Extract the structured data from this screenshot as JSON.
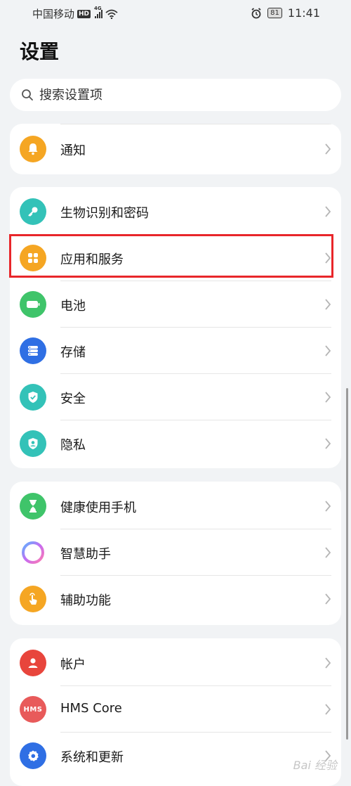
{
  "status_bar": {
    "carrier": "中国移动",
    "hd_badge": "HD",
    "network": "4G",
    "battery": "81",
    "time": "11:41"
  },
  "page": {
    "title": "设置"
  },
  "search": {
    "placeholder": "搜索设置项"
  },
  "groups": [
    {
      "items": [
        {
          "label": "通知",
          "icon": "bell-icon",
          "color": "#f5a623"
        }
      ]
    },
    {
      "items": [
        {
          "label": "生物识别和密码",
          "icon": "key-icon",
          "color": "#33c2b8"
        },
        {
          "label": "应用和服务",
          "icon": "apps-grid-icon",
          "color": "#f5a623"
        },
        {
          "label": "电池",
          "icon": "battery-icon",
          "color": "#3fc46a"
        },
        {
          "label": "存储",
          "icon": "storage-icon",
          "color": "#2f6fe4"
        },
        {
          "label": "安全",
          "icon": "shield-check-icon",
          "color": "#33c2b8"
        },
        {
          "label": "隐私",
          "icon": "privacy-user-icon",
          "color": "#33c2b8"
        }
      ]
    },
    {
      "items": [
        {
          "label": "健康使用手机",
          "icon": "hourglass-icon",
          "color": "#3fc46a"
        },
        {
          "label": "智慧助手",
          "icon": "assistant-ring-icon",
          "color": "#c66bf2"
        },
        {
          "label": "辅助功能",
          "icon": "hand-tap-icon",
          "color": "#f5a623"
        }
      ]
    },
    {
      "items": [
        {
          "label": "帐户",
          "icon": "account-icon",
          "color": "#e8453c"
        },
        {
          "label": "HMS Core",
          "icon": "hms-core-icon",
          "icon_text": "HMS",
          "color": "#e85a5a"
        },
        {
          "label": "系统和更新",
          "icon": "gear-icon",
          "color": "#2f6fe4"
        }
      ]
    }
  ],
  "watermark": "Bai 经验"
}
